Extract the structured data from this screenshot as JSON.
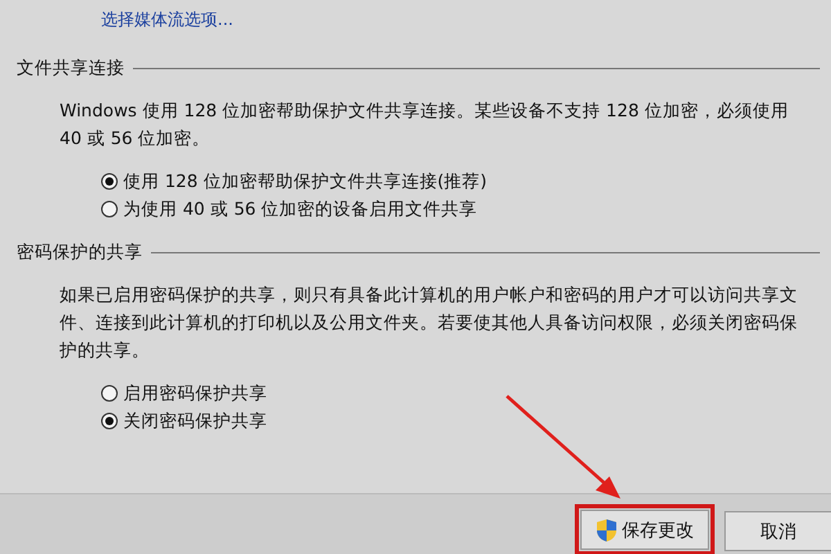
{
  "link": "选择媒体流选项...",
  "sections": [
    {
      "title": "文件共享连接",
      "description": "Windows 使用 128 位加密帮助保护文件共享连接。某些设备不支持 128 位加密，必须使用 40 或 56 位加密。",
      "options": [
        {
          "label": "使用 128 位加密帮助保护文件共享连接(推荐)",
          "selected": true
        },
        {
          "label": "为使用 40 或 56 位加密的设备启用文件共享",
          "selected": false
        }
      ]
    },
    {
      "title": "密码保护的共享",
      "description": "如果已启用密码保护的共享，则只有具备此计算机的用户帐户和密码的用户才可以访问共享文件、连接到此计算机的打印机以及公用文件夹。若要使其他人具备访问权限，必须关闭密码保护的共享。",
      "options": [
        {
          "label": "启用密码保护共享",
          "selected": false
        },
        {
          "label": "关闭密码保护共享",
          "selected": true
        }
      ]
    }
  ],
  "buttons": [
    {
      "label": "保存更改",
      "kind": "shield",
      "highlighted": true
    },
    {
      "label": "取消",
      "kind": "plain",
      "highlighted": false
    }
  ]
}
